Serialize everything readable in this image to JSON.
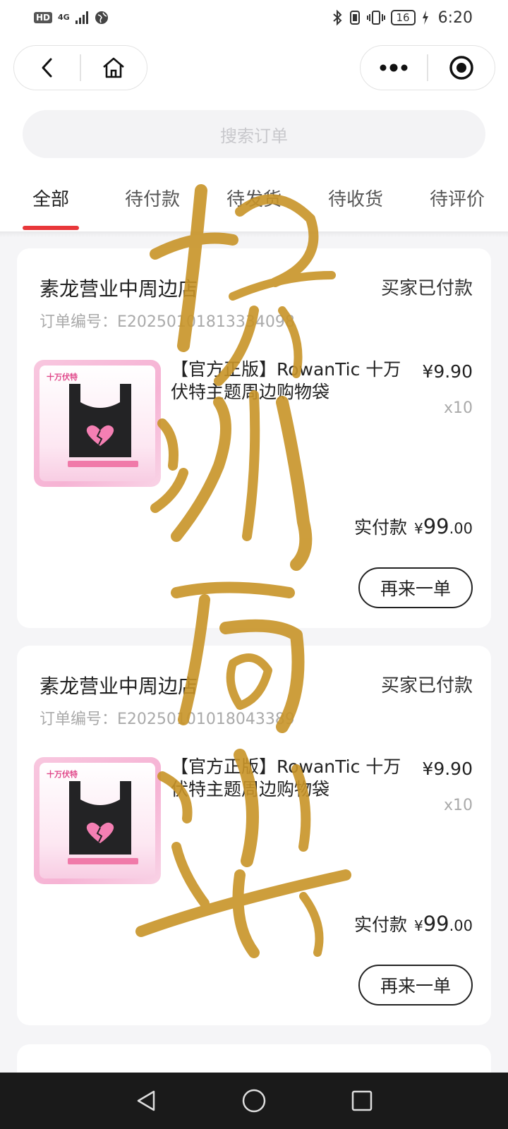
{
  "status_bar": {
    "hd": "HD",
    "network": "4G",
    "battery": "16",
    "time": "6:20"
  },
  "nav": {
    "back_icon": "chevron-left-icon",
    "home_icon": "home-icon",
    "more_icon": "more-dots-icon",
    "close_icon": "target-circle-icon"
  },
  "search": {
    "placeholder": "搜索订单"
  },
  "tabs": [
    {
      "label": "全部",
      "active": true
    },
    {
      "label": "待付款",
      "active": false
    },
    {
      "label": "待发货",
      "active": false
    },
    {
      "label": "待收货",
      "active": false
    },
    {
      "label": "待评价",
      "active": false
    }
  ],
  "orders": [
    {
      "shop_name": "素龙营业中周边店",
      "status": "买家已付款",
      "order_no": "订单编号：E20250101813334098…",
      "product_title": "【官方正版】RowanTic 十万伏特主题周边购物袋",
      "price": "¥9.90",
      "qty": "x10",
      "paid_label": "实付款",
      "paid_currency": "¥",
      "paid_int": "99",
      "paid_dec": ".00",
      "reorder_label": "再来一单",
      "thumb_caption": "十万伏特"
    },
    {
      "shop_name": "素龙营业中周边店",
      "status": "买家已付款",
      "order_no": "订单编号：E20250101018043389…",
      "product_title": "【官方正版】RowanTic 十万伏特主题周边购物袋",
      "price": "¥9.90",
      "qty": "x10",
      "paid_label": "实付款",
      "paid_currency": "¥",
      "paid_int": "99",
      "paid_dec": ".00",
      "reorder_label": "再来一单",
      "thumb_caption": "十万伏特"
    }
  ],
  "watermark_text": "拾流的光",
  "colors": {
    "accent": "#e8373a",
    "watermark_gold": "#c89428"
  }
}
